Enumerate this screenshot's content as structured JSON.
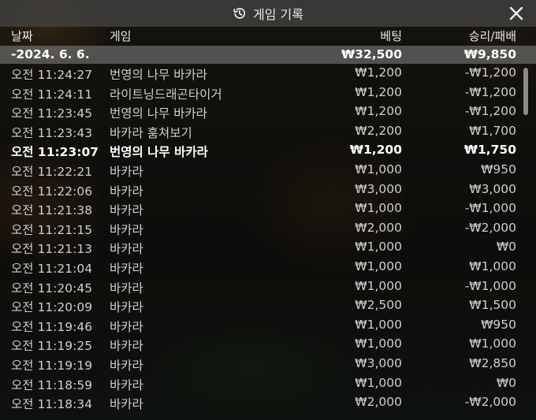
{
  "header": {
    "title": "게임 기록",
    "icon": "history-icon",
    "close_icon": "close-icon"
  },
  "columns": {
    "date": "날짜",
    "game": "게임",
    "bet": "베팅",
    "winloss": "승리/패배"
  },
  "date_group": {
    "date": "-2024. 6. 6.",
    "bet_total": "₩32,500",
    "winloss_total": "₩9,850"
  },
  "rows": [
    {
      "time": "오전 11:24:27",
      "game": "번영의 나무 바카라",
      "bet": "₩1,200",
      "winloss": "-₩1,200"
    },
    {
      "time": "오전 11:24:11",
      "game": "라이트닝드래곤타이거",
      "bet": "₩1,200",
      "winloss": "-₩1,200"
    },
    {
      "time": "오전 11:23:45",
      "game": "번영의 나무 바카라",
      "bet": "₩1,200",
      "winloss": "-₩1,200"
    },
    {
      "time": "오전 11:23:43",
      "game": "바카라 훔쳐보기",
      "bet": "₩2,200",
      "winloss": "₩1,700"
    },
    {
      "time": "오전 11:23:07",
      "game": "번영의 나무 바카라",
      "bet": "₩1,200",
      "winloss": "₩1,750"
    },
    {
      "time": "오전 11:22:21",
      "game": "바카라",
      "bet": "₩1,000",
      "winloss": "₩950"
    },
    {
      "time": "오전 11:22:06",
      "game": "바카라",
      "bet": "₩3,000",
      "winloss": "₩3,000"
    },
    {
      "time": "오전 11:21:38",
      "game": "바카라",
      "bet": "₩1,000",
      "winloss": "-₩1,000"
    },
    {
      "time": "오전 11:21:15",
      "game": "바카라",
      "bet": "₩2,000",
      "winloss": "-₩2,000"
    },
    {
      "time": "오전 11:21:13",
      "game": "바카라",
      "bet": "₩1,000",
      "winloss": "₩0"
    },
    {
      "time": "오전 11:21:04",
      "game": "바카라",
      "bet": "₩1,000",
      "winloss": "₩1,000"
    },
    {
      "time": "오전 11:20:45",
      "game": "바카라",
      "bet": "₩1,000",
      "winloss": "-₩1,000"
    },
    {
      "time": "오전 11:20:09",
      "game": "바카라",
      "bet": "₩2,500",
      "winloss": "₩1,500"
    },
    {
      "time": "오전 11:19:46",
      "game": "바카라",
      "bet": "₩1,000",
      "winloss": "₩950"
    },
    {
      "time": "오전 11:19:25",
      "game": "바카라",
      "bet": "₩1,000",
      "winloss": "₩1,000"
    },
    {
      "time": "오전 11:19:19",
      "game": "바카라",
      "bet": "₩3,000",
      "winloss": "₩2,850"
    },
    {
      "time": "오전 11:18:59",
      "game": "바카라",
      "bet": "₩1,000",
      "winloss": "₩0"
    },
    {
      "time": "오전 11:18:34",
      "game": "바카라",
      "bet": "₩2,000",
      "winloss": "-₩2,000"
    }
  ]
}
